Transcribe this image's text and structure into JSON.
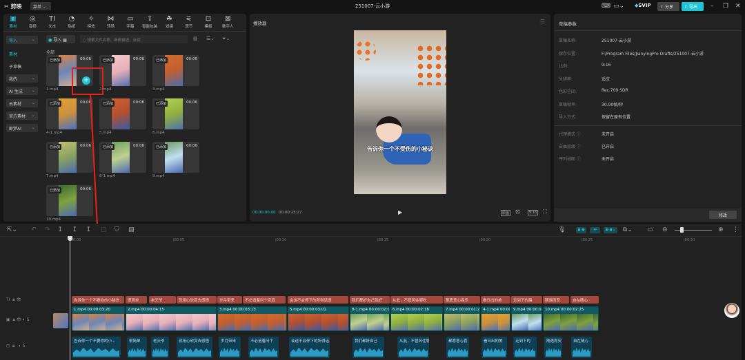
{
  "app": {
    "name": "剪映",
    "menu": "菜单",
    "title": "251007-云小游",
    "svip": "SVIP",
    "share": "分享",
    "export": "导出"
  },
  "colors": {
    "accent": "#1fc4d6",
    "text_clip": "#a4483d",
    "video_clip": "#0f5a63",
    "audio_clip": "#0d3f55",
    "highlight": "#e0231a"
  },
  "tools": [
    {
      "label": "素材",
      "icon": "media-icon",
      "active": true
    },
    {
      "label": "音频",
      "icon": "audio-icon"
    },
    {
      "label": "文本",
      "icon": "text-icon"
    },
    {
      "label": "贴纸",
      "icon": "sticker-icon"
    },
    {
      "label": "特效",
      "icon": "effects-icon"
    },
    {
      "label": "转场",
      "icon": "transition-icon"
    },
    {
      "label": "字幕",
      "icon": "caption-icon"
    },
    {
      "label": "智能包装",
      "icon": "smart-package-icon"
    },
    {
      "label": "滤镜",
      "icon": "filter-icon"
    },
    {
      "label": "调节",
      "icon": "adjust-icon"
    },
    {
      "label": "模板",
      "icon": "template-icon"
    },
    {
      "label": "数字人",
      "icon": "digital-human-icon"
    }
  ],
  "sidebar": [
    {
      "label": "导入",
      "box": true,
      "active": true
    },
    {
      "label": "素材",
      "active": true
    },
    {
      "label": "子草稿"
    },
    {
      "label": "我的",
      "box": true
    },
    {
      "label": "AI 生成",
      "box": true
    },
    {
      "label": "云素材",
      "box": true
    },
    {
      "label": "官方素材",
      "box": true
    },
    {
      "label": "即梦AI",
      "box": true
    }
  ],
  "media": {
    "import_label": "导入",
    "search_placeholder": "搜索文件名称、画面描述、台词",
    "section": "全部",
    "items": [
      {
        "name": "1.mp4",
        "badge": "已添加",
        "duration": "00:06"
      },
      {
        "name": "2.mp4",
        "badge": "已添加",
        "duration": "00:06"
      },
      {
        "name": "3.mp4",
        "badge": "已添加",
        "duration": "00:06"
      },
      {
        "name": "4-1.mp4",
        "badge": "已添加",
        "duration": "00:06"
      },
      {
        "name": "5.mp4",
        "badge": "已添加",
        "duration": "00:06"
      },
      {
        "name": "6.mp4",
        "badge": "已添加",
        "duration": "00:06"
      },
      {
        "name": "7.mp4",
        "badge": "已添加",
        "duration": "00:06"
      },
      {
        "name": "8-1.mp4",
        "badge": "已添加",
        "duration": "00:06"
      },
      {
        "name": "9.mp4",
        "badge": "已添加",
        "duration": "00:06"
      },
      {
        "name": "10.mp4",
        "badge": "已添加",
        "duration": "00:06"
      }
    ]
  },
  "player": {
    "title": "播放器",
    "subtitle": "告诉你一个不受伤的小秘诀",
    "current": "00:00:00:00",
    "total": "00:00:25:27",
    "btn_quality": "原画",
    "btn_ratio": "9:16"
  },
  "draft": {
    "title": "草稿参数",
    "rows": [
      {
        "k": "草稿名称:",
        "v": "251007-云小游"
      },
      {
        "k": "保存位置:",
        "v": "F:/Program Files/JianyingPro Drafts/251007-云小游"
      },
      {
        "k": "比例:",
        "v": "9:16"
      },
      {
        "k": "分辨率:",
        "v": "适应"
      },
      {
        "k": "色彩空间:",
        "v": "Rec.709 SDR"
      },
      {
        "k": "草稿帧率:",
        "v": "30.00帧/秒"
      },
      {
        "k": "导入方式:",
        "v": "保留在原有位置"
      }
    ],
    "rows2": [
      {
        "k": "代理模式 ⓘ",
        "v": "未开启"
      },
      {
        "k": "自由层级 ⓘ",
        "v": "已开启"
      },
      {
        "k": "序列帧图 ⓘ",
        "v": "未开启"
      }
    ],
    "modify": "修改"
  },
  "timeline": {
    "ruler": [
      "00:00",
      "|00:05",
      "|00:10",
      "|00:15",
      "|00:20",
      "|00:25",
      "|00:30"
    ],
    "zoom_level": 0.15,
    "text_clips": [
      "告诉你一个不要你的小秘诀",
      "很简单",
      "老天爷",
      "就用心欣赏去感悟",
      "岁月带来",
      "不必追着问个究竟",
      "会送不会停下的所得话语",
      "我们都好自己就好",
      "从此，不管风往哪吹",
      "都愿意心喜乐",
      "看日出的美",
      "走到下的路",
      "随遇而安",
      "自在随心"
    ],
    "video_clips": [
      {
        "name": "1.mp4",
        "dur": "00:00:03:20"
      },
      {
        "name": "2.mp4",
        "dur": "00:00:04:15"
      },
      {
        "name": "3.mp4",
        "dur": "00:00:03:13"
      },
      {
        "name": "5.mp4",
        "dur": "00:00:03:01"
      },
      {
        "name": "8-1.mp4",
        "dur": "00:00:02:0"
      },
      {
        "name": "6.mp4",
        "dur": "00:00:02:18"
      },
      {
        "name": "7.mp4",
        "dur": "00:00:01:2"
      },
      {
        "name": "4-1.mp4",
        "dur": "00:00"
      },
      {
        "name": "9.mp4",
        "dur": "00:00:0"
      },
      {
        "name": "10.mp4",
        "dur": "00:00:02:25"
      }
    ],
    "audio_clips": [
      "告诉你一个不要你的小...",
      "很简单",
      "老天爷",
      "就用心欣赏去感悟",
      "岁月带来",
      "不必追着问个",
      "会送不会停下的所得话...",
      "我们都好自己",
      "从此，不管风往哪吹",
      "都愿意心喜",
      "看日出的美",
      "走到下的",
      "随遇而安",
      "自在随心"
    ]
  }
}
